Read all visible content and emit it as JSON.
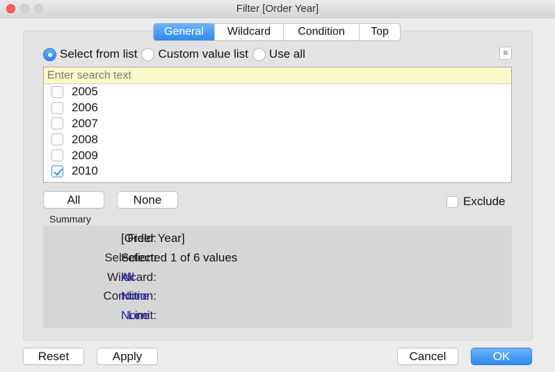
{
  "window": {
    "title": "Filter [Order Year]"
  },
  "tabs": [
    {
      "label": "General",
      "active": true
    },
    {
      "label": "Wildcard",
      "active": false
    },
    {
      "label": "Condition",
      "active": false
    },
    {
      "label": "Top",
      "active": false
    }
  ],
  "mode": {
    "options": [
      {
        "label": "Select from list",
        "selected": true
      },
      {
        "label": "Custom value list",
        "selected": false
      },
      {
        "label": "Use all",
        "selected": false
      }
    ],
    "menu_icon": "≡"
  },
  "list": {
    "search_placeholder": "Enter search text",
    "items": [
      {
        "label": "2005",
        "checked": false
      },
      {
        "label": "2006",
        "checked": false
      },
      {
        "label": "2007",
        "checked": false
      },
      {
        "label": "2008",
        "checked": false
      },
      {
        "label": "2009",
        "checked": false
      },
      {
        "label": "2010",
        "checked": true
      }
    ]
  },
  "selection_buttons": {
    "all": "All",
    "none": "None"
  },
  "exclude": {
    "label": "Exclude",
    "checked": false
  },
  "summary": {
    "heading": "Summary",
    "rows": [
      {
        "label": "Field:",
        "value": "[Order Year]",
        "link": false
      },
      {
        "label": "Selection:",
        "value": "Selected 1 of 6 values",
        "link": false
      },
      {
        "label": "Wildcard:",
        "value": "All",
        "link": true
      },
      {
        "label": "Condition:",
        "value": "None",
        "link": true
      },
      {
        "label": "Limit:",
        "value": "None",
        "link": true
      }
    ]
  },
  "footer": {
    "reset": "Reset",
    "apply": "Apply",
    "cancel": "Cancel",
    "ok": "OK"
  },
  "colors": {
    "accent": "#2f8af0",
    "link": "#1a1ad6",
    "search_bg": "#fcf9c8",
    "close": "#fe5f57"
  }
}
